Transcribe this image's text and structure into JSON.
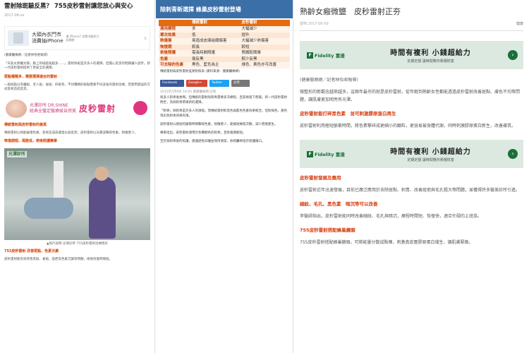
{
  "panel1": {
    "title": "雷射除斑驗反黑？ 755皮秒雷射讓您放心與安心",
    "meta": "2017-06-xx",
    "ad": {
      "brand": "大碩內衣門市",
      "line1": "消費抽iPhone",
      "fine": "搶 iPhone7 消費活動即日起開跑"
    },
    "byline": "(健康醫療網／記者林怡君報導)",
    "intro": "「天氣炎熱曬太陽，臉上的斑越長越多……」雷射除斑是許多人的選擇，但擔心反黑的問題讓人卻步。新一代皮秒雷射提供了更安全的選擇。",
    "h1": "斑點種類多，需要選擇適合的雷射",
    "p1": "一般斑點分為曬斑、老人斑、雀斑、肝斑等，不同種類的斑點需要不同波長的雷射治療，若使用錯誤的方式容易造成反黑。",
    "shine": {
      "tagline": "光澤診所 DR.SHINE",
      "sub": "經典全盤定醫療級自然美",
      "headline": "皮秒雷射"
    },
    "h2": "傳統雷射與皮秒雷射的差異",
    "p2": "傳統雷射以熱能破壞色素，容易造成皮膚發炎與反黑；皮秒雷射以光震波擊碎色素，熱傷害少。",
    "h3": "恢復期短、風險低，術後照護簡單",
    "photo_tag": "光澤診所",
    "caption": "▲照片說明 光澤診所 755皮秒雷射治療情形",
    "h4": "755皮秒雷射 改善斑點、色素沉澱",
    "p4": "皮秒雷射能有效改善黑斑、雀斑、痘疤及色素沉澱等問題，術後恢復時間短。"
  },
  "panel2": {
    "banner": "除刺青新選擇 蜂巢皮秒雷射登場",
    "table": {
      "headers": [
        "",
        "傳統雷射",
        "皮秒雷射"
      ],
      "rows": [
        [
          "適用療程",
          "多",
          "大幅減少"
        ],
        [
          "單次效果",
          "低",
          "提升"
        ],
        [
          "熱傷害",
          "易造成皮膚組織傷害",
          "大幅減少熱傷害"
        ],
        [
          "恢復期",
          "較長",
          "較短"
        ],
        [
          "術後照護",
          "需長時間照護",
          "照護較簡單"
        ],
        [
          "色素",
          "易反黑",
          "較少反黑"
        ],
        [
          "可去除的色素",
          "黑色、藍色為主",
          "綠色、黃色亦可改善"
        ]
      ]
    },
    "note": "傳統雷射與皮秒雷射差異對照表 (資料來源：健康醫療網)",
    "social": [
      "Facebook",
      "Google+",
      "Twitter",
      "分享"
    ],
    "date": "2015年5月9日 18:00 健康醫療網 記者",
    "paras": [
      "很多人刺青後後悔，但傳統的雷射除刺青需要多次療程，且容易留下疤痕。新一代皮秒雷射問世，為除刺青帶來新的選擇。",
      "「刺青」除刺青是許多人的煩惱，而傳統雷射對黑色與藍色色素效果較佳，但對綠色、黃色等彩色刺青效果有限。",
      "皮秒雷射以極短的脈衝時間擊碎色素，熱傷害少，能縮短療程次數，減少疤痕產生。",
      "專家指出，皮秒雷射適用於各種顏色的刺青，且恢復期較短。",
      "至於除刺青後的照護，建議避免日曬並保持清潔，依照醫師指示照護傷口。"
    ]
  },
  "panel3": {
    "title": "熟齡女瘢微鹽　皮秒雷射正夯",
    "date": "發佈 2017-06-09",
    "health": "健康",
    "ad": {
      "brand": "Fidelity 富達",
      "headline": "時間有複利 小錢超給力",
      "sub": "定期定額 讓時間幫你累積財富"
    },
    "source": "(健康醫療網／記者林怡君報導)",
    "p1": "微整形的新觀念越來越多，這兩年最夯的就是皮秒雷射。從年輕到熟齡女性都能透過皮秒雷射改善斑點、膚色不均等問題，讓肌膚更加明亮有光澤。",
    "h1": "皮秒雷射能打碎黑色素　並可刺激膠原蛋白再生",
    "p2": "皮秒雷射利用極短脈衝時間，將色素擊碎成更細小的顆粒，更容易被身體代謝，同時刺激膠原蛋白新生，改善膚質。",
    "h2": "皮秒雷射發展及應用",
    "p3": "皮秒雷射近年迅速發展，目前已廣泛應用於去除斑點、刺青、改善痘疤與毛孔粗大等問題，並獲得許多醫美診所引進。",
    "h3": "細紋、毛孔、黑色素　暗沉等可以改善",
    "p4": "李醫師指出，皮秒雷射能同時改善細紋、毛孔與暗沉，療程時間短、恢復快，適合忙碌的上班族。",
    "h4": "755皮秒雷射搭配蜂巢鏡頭",
    "p5": "755皮秒雷射搭配蜂巢鏡頭，可將能量分散成點陣，刺激真皮層膠原蛋白增生，讓肌膚緊緻。"
  }
}
